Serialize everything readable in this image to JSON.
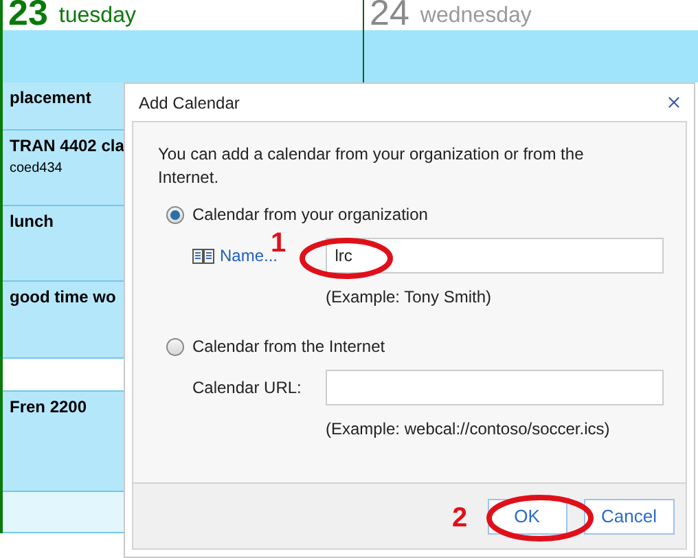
{
  "days": [
    {
      "number": "23",
      "name": "tuesday",
      "today": true
    },
    {
      "number": "24",
      "name": "wednesday",
      "today": false
    }
  ],
  "events": [
    {
      "kind": "event",
      "title": "placement"
    },
    {
      "kind": "event",
      "title": "TRAN 4402 cla",
      "subtitle": "coed434"
    },
    {
      "kind": "event",
      "title": "lunch"
    },
    {
      "kind": "event",
      "title": "good time wo"
    },
    {
      "kind": "free"
    },
    {
      "kind": "event",
      "title": "Fren 2200"
    },
    {
      "kind": "light"
    }
  ],
  "dialog": {
    "title": "Add Calendar",
    "intro": "You can add a calendar from your organization or from the Internet.",
    "options": [
      {
        "label": "Calendar from your organization",
        "selected": true,
        "kind": "link",
        "field_label": "Name...",
        "value": "lrc",
        "example": "(Example: Tony Smith)"
      },
      {
        "label": "Calendar from the Internet",
        "selected": false,
        "kind": "label",
        "field_label": "Calendar URL:",
        "example": "(Example: webcal://contoso/soccer.ics)"
      }
    ],
    "buttons": [
      "OK",
      "Cancel"
    ]
  },
  "annotations": [
    "1",
    "2"
  ]
}
